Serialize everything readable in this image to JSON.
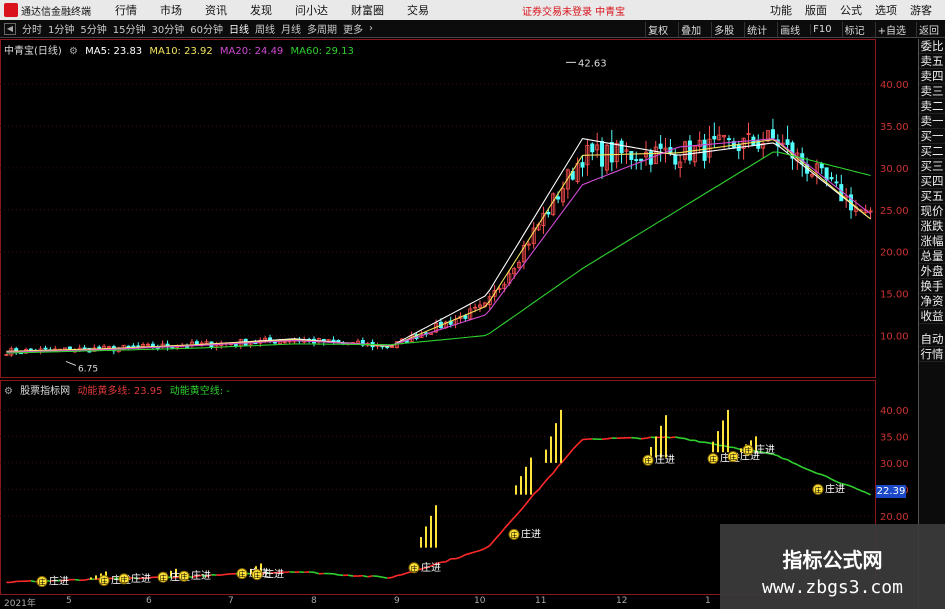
{
  "menubar": {
    "app_name": "通达信金融终端",
    "items": [
      "行情",
      "市场",
      "资讯",
      "发现",
      "问小达",
      "财富圈",
      "交易"
    ],
    "notice": "证券交易未登录  中青宝",
    "right": [
      "功能",
      "版面",
      "公式",
      "选项",
      "游客"
    ]
  },
  "toolbar": {
    "periods": [
      "分时",
      "1分钟",
      "5分钟",
      "15分钟",
      "30分钟",
      "60分钟",
      "日线",
      "周线",
      "月线",
      "多周期",
      "更多"
    ],
    "active_period": "日线",
    "right": [
      "复权",
      "叠加",
      "多股",
      "统计",
      "画线",
      "F10",
      "标记",
      "+自选",
      "返回"
    ]
  },
  "main_legend": {
    "stock": "中青宝(日线)",
    "ma5": "MA5: 23.83",
    "ma10": "MA10: 23.92",
    "ma20": "MA20: 24.49",
    "ma60": "MA60: 29.13",
    "colors": {
      "ma5": "#ffffff",
      "ma10": "#f3e35b",
      "ma20": "#d24bd6",
      "ma60": "#2fd12f"
    }
  },
  "sub_legend": {
    "name": "股票指标网",
    "line1": "动能黄多线: 23.95",
    "line2": "动能黄空线: -",
    "colors": {
      "line1": "#e03a3a",
      "line2": "#2fd12f"
    }
  },
  "main_axis": {
    "ticks": [
      "40.00",
      "35.00",
      "30.00",
      "25.00",
      "20.00",
      "15.00",
      "10.00"
    ]
  },
  "sub_axis": {
    "ticks": [
      "40.00",
      "35.00",
      "30.00",
      "25.00",
      "20.00"
    ],
    "current": "22.39"
  },
  "annotations": {
    "high": "42.63",
    "low": "6.75",
    "zhuangjin": "庄进",
    "badge": "庄"
  },
  "xaxis": {
    "labels": [
      "2021年",
      "5",
      "6",
      "7",
      "8",
      "9",
      "10",
      "11",
      "12",
      "1"
    ]
  },
  "sidepanel": {
    "top": [
      "委比",
      "卖五",
      "卖四",
      "卖三",
      "卖二",
      "卖一",
      "买一",
      "买二",
      "买三",
      "买四",
      "买五",
      "现价",
      "涨跌",
      "涨幅",
      "总量",
      "外盘",
      "换手",
      "净资",
      "收益"
    ],
    "bottom": [
      "自动",
      "行情"
    ]
  },
  "watermark": {
    "title": "指标公式网",
    "url": "www.zbgs3.com"
  },
  "chart_data": [
    {
      "type": "candlestick",
      "title": "中青宝(日线)",
      "x": [
        "2021-04",
        "2021-05",
        "2021-06",
        "2021-07",
        "2021-08",
        "2021-09",
        "2021-10",
        "2021-11",
        "2021-12",
        "2022-01"
      ],
      "ylim": [
        6,
        43
      ],
      "y_ticks": [
        10,
        15,
        20,
        25,
        30,
        35,
        40
      ],
      "annotations": [
        {
          "label": "42.63",
          "type": "high"
        },
        {
          "label": "6.75",
          "type": "low"
        }
      ],
      "series": [
        {
          "name": "MA5",
          "values": [
            8.1,
            8.4,
            8.9,
            9.6,
            8.7,
            14.8,
            33.5,
            31.5,
            33.0,
            23.9
          ]
        },
        {
          "name": "MA10",
          "values": [
            8.1,
            8.4,
            8.9,
            9.5,
            8.7,
            13.5,
            31.5,
            31.8,
            33.4,
            23.9
          ]
        },
        {
          "name": "MA20",
          "values": [
            8.0,
            8.3,
            8.8,
            9.4,
            8.8,
            12.5,
            28.0,
            32.5,
            33.5,
            24.5
          ]
        },
        {
          "name": "MA60",
          "values": [
            7.9,
            8.2,
            8.5,
            9.0,
            8.9,
            10.0,
            18.0,
            25.0,
            32.0,
            29.1
          ]
        }
      ]
    },
    {
      "type": "line",
      "title": "股票指标网",
      "x": [
        "2021-04",
        "2021-05",
        "2021-06",
        "2021-07",
        "2021-08",
        "2021-09",
        "2021-10",
        "2021-11",
        "2021-12",
        "2022-01"
      ],
      "ylim": [
        6,
        43
      ],
      "y_ticks": [
        20,
        25,
        30,
        35,
        40
      ],
      "series": [
        {
          "name": "动能黄多线",
          "values": [
            7.5,
            8.0,
            8.6,
            9.5,
            8.3,
            13.8,
            34.5,
            34.8,
            31.5,
            23.9
          ]
        },
        {
          "name": "动能黄空线",
          "values": [
            7.5,
            8.0,
            8.6,
            9.3,
            8.3,
            13.0,
            33.0,
            31.5,
            31.0,
            23.0
          ]
        }
      ],
      "markers": [
        {
          "label": "庄进"
        }
      ]
    }
  ]
}
